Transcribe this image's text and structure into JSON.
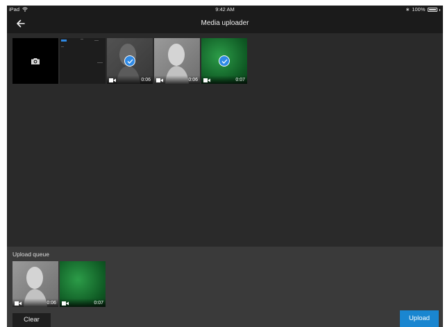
{
  "status_bar": {
    "device": "iPad",
    "time": "9:42 AM",
    "battery": "100%"
  },
  "nav": {
    "title": "Media uploader",
    "back_icon": "arrow-left-icon"
  },
  "media": [
    {
      "kind": "camera",
      "icon": "camera-icon"
    },
    {
      "kind": "screenshot"
    },
    {
      "kind": "video",
      "thumb": "bust-gray",
      "duration": "0:06",
      "selected": true
    },
    {
      "kind": "video",
      "thumb": "bust-light",
      "duration": "0:06",
      "selected": false
    },
    {
      "kind": "video",
      "thumb": "green-cloth",
      "duration": "0:07",
      "selected": true
    }
  ],
  "queue": {
    "label": "Upload queue",
    "items": [
      {
        "thumb": "bust-light",
        "duration": "0:06"
      },
      {
        "thumb": "green-cloth",
        "duration": "0:07"
      }
    ]
  },
  "actions": {
    "clear_label": "Clear",
    "upload_label": "Upload"
  },
  "colors": {
    "accent": "#1a86d0",
    "check": "#2f8ae5",
    "background": "#2a2a2a",
    "bar": "#1b1b1b",
    "queue_panel": "#3a3a3a"
  }
}
